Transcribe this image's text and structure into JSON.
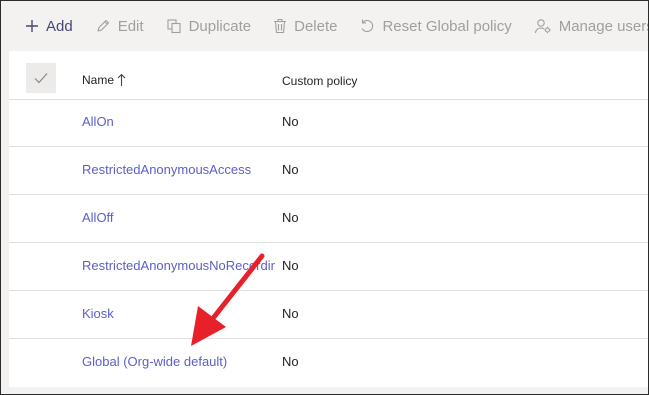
{
  "toolbar": {
    "add_label": "Add",
    "edit_label": "Edit",
    "duplicate_label": "Duplicate",
    "delete_label": "Delete",
    "reset_label": "Reset Global policy",
    "manage_label": "Manage users"
  },
  "table": {
    "columns": {
      "name": "Name",
      "custom_policy": "Custom policy"
    },
    "rows": [
      {
        "name": "AllOn",
        "custom_policy": "No"
      },
      {
        "name": "RestrictedAnonymousAccess",
        "custom_policy": "No"
      },
      {
        "name": "AllOff",
        "custom_policy": "No"
      },
      {
        "name": "RestrictedAnonymousNoRecording",
        "custom_policy": "No"
      },
      {
        "name": "Kiosk",
        "custom_policy": "No"
      },
      {
        "name": "Global (Org-wide default)",
        "custom_policy": "No"
      }
    ]
  },
  "colors": {
    "accent": "#5b5fc7",
    "active_toolbar": "#464775",
    "disabled_toolbar": "#a19f9d",
    "annotation_arrow": "#e8202a"
  }
}
